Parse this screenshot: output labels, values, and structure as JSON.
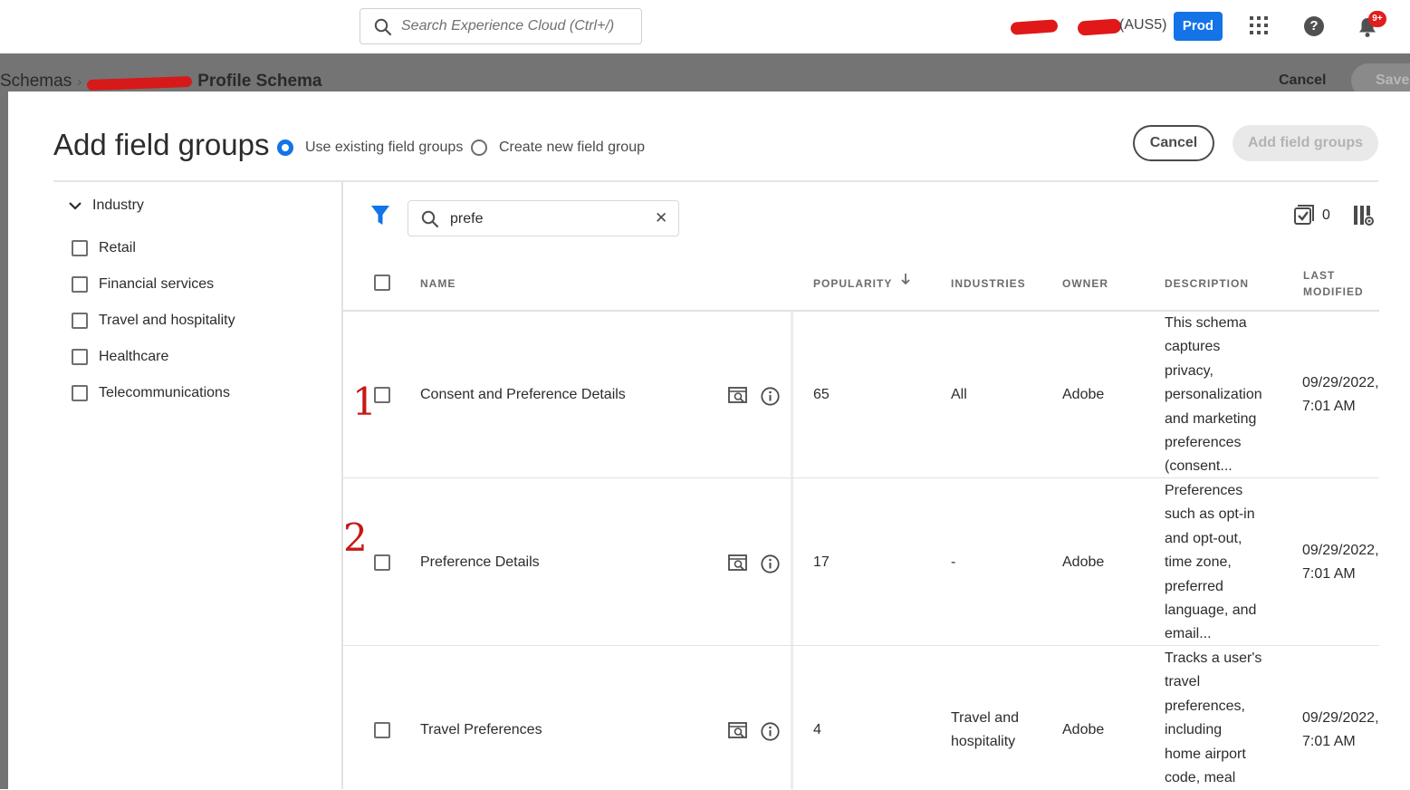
{
  "topbar": {
    "search_placeholder": "Search Experience Cloud (Ctrl+/)",
    "org_suffix": "(AUS5)",
    "env_badge": "Prod",
    "notifications_badge": "9+"
  },
  "background_page": {
    "breadcrumb_root": "Schemas",
    "breadcrumb_title": "Profile Schema",
    "cancel_label": "Cancel",
    "save_label": "Save"
  },
  "dialog": {
    "title": "Add field groups",
    "radio_existing": "Use existing field groups",
    "radio_new": "Create new field group",
    "cancel_label": "Cancel",
    "add_label": "Add field groups",
    "selected_option": "existing"
  },
  "facets": {
    "group_label": "Industry",
    "items": [
      "Retail",
      "Financial services",
      "Travel and hospitality",
      "Healthcare",
      "Telecommunications"
    ]
  },
  "table": {
    "search_value": "prefe",
    "selected_count": "0",
    "headers": {
      "name": "NAME",
      "popularity": "POPULARITY",
      "industries": "INDUSTRIES",
      "owner": "OWNER",
      "description": "DESCRIPTION",
      "last_modified_1": "LAST",
      "last_modified_2": "MODIFIED"
    },
    "rows": [
      {
        "name": "Consent and Preference Details",
        "popularity": "65",
        "industries_1": "All",
        "industries_2": "",
        "owner": "Adobe",
        "description": [
          "This schema",
          "captures",
          "privacy,",
          "personalization",
          "and marketing",
          "preferences",
          "(consent..."
        ],
        "modified_date": "09/29/2022,",
        "modified_time": "7:01 AM"
      },
      {
        "name": "Preference Details",
        "popularity": "17",
        "industries_1": "-",
        "industries_2": "",
        "owner": "Adobe",
        "description": [
          "Preferences",
          "such as opt-in",
          "and opt-out,",
          "time zone,",
          "preferred",
          "language, and",
          "email..."
        ],
        "modified_date": "09/29/2022,",
        "modified_time": "7:01 AM"
      },
      {
        "name": "Travel Preferences",
        "popularity": "4",
        "industries_1": "Travel and",
        "industries_2": "hospitality",
        "owner": "Adobe",
        "description": [
          "Tracks a user's",
          "travel",
          "preferences,",
          "including",
          "home airport",
          "code, meal",
          ""
        ],
        "modified_date": "09/29/2022,",
        "modified_time": "7:01 AM"
      }
    ]
  },
  "annotations": [
    "1",
    "2"
  ],
  "colors": {
    "accent": "#1473e6",
    "redaction": "#e01818",
    "badge": "#e21d1d"
  },
  "icons": [
    "search-icon",
    "apps-grid-icon",
    "help-icon",
    "bell-icon",
    "filter-icon",
    "clear-icon",
    "chevron-down-icon",
    "select-all-icon",
    "column-settings-icon",
    "preview-icon",
    "info-icon",
    "sort-desc-icon"
  ]
}
